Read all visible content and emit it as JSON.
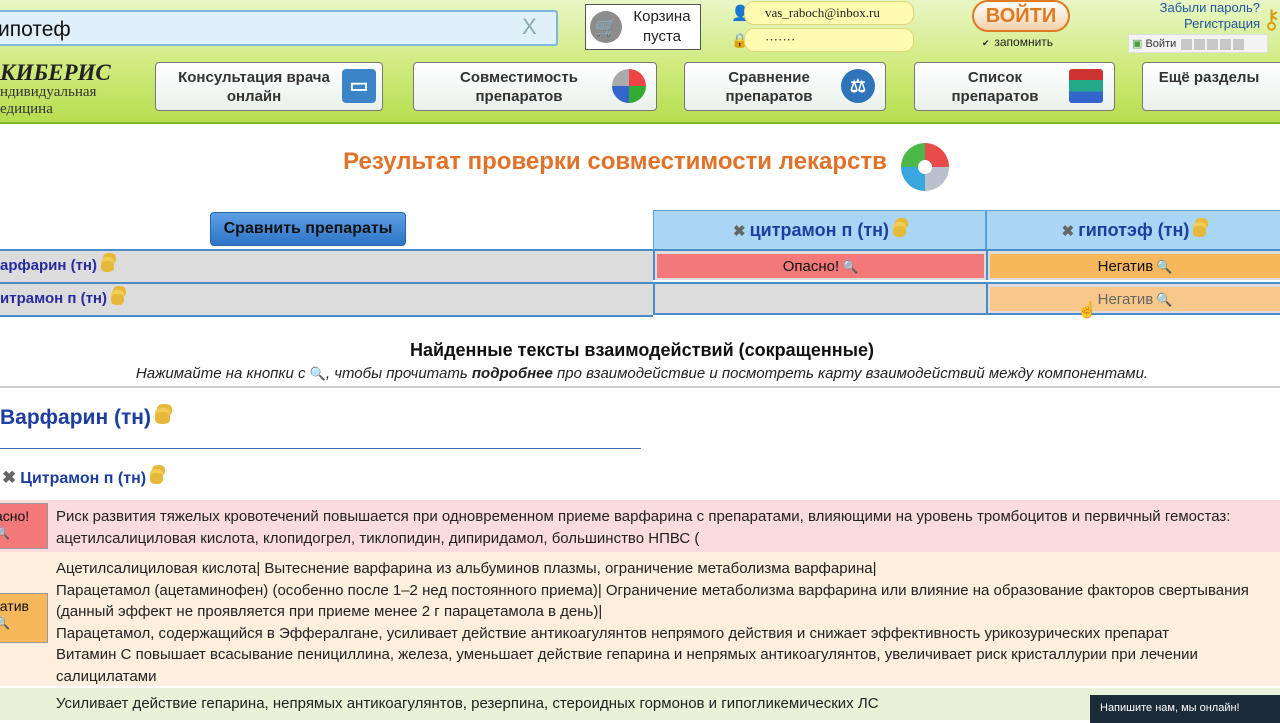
{
  "header": {
    "search_value": "ипотеф",
    "search_clear": "X",
    "cart_label": "Корзина пуста",
    "login_user": "vas_raboch@inbox.ru",
    "login_password": "·······",
    "login_button": "ВОЙТИ",
    "remember_label": "запомнить",
    "forgot_password": "Забыли пароль?",
    "register": "Регистрация",
    "social_label": "Войти",
    "logo_title": "КИБЕРИС",
    "logo_subtitle": "ндивидуальная едицина"
  },
  "nav": [
    {
      "label": "Консультация врача онлайн",
      "icon": "monitor-icon"
    },
    {
      "label": "Совместимость препаратов",
      "icon": "puzzle-icon"
    },
    {
      "label": "Сравнение препаратов",
      "icon": "scales-icon"
    },
    {
      "label": "Список препаратов",
      "icon": "books-icon"
    },
    {
      "label": "Ещё разделы",
      "icon": ""
    }
  ],
  "page_title": "Результат проверки совместимости лекарств",
  "compare_button": "Сравнить препараты",
  "table": {
    "columns": [
      "цитрамон п (тн)",
      "гипотэф (тн)"
    ],
    "rows": [
      {
        "label": "арфарин (тн)",
        "cells": [
          "Опасно!",
          "Негатив"
        ]
      },
      {
        "label": "итрамон п (тн)",
        "cells": [
          "",
          "Негатив"
        ]
      }
    ]
  },
  "found": {
    "title": "Найденные тексты взаимодействий (сокращенные)",
    "hint_prefix": "Нажимайте на кнопки с",
    "hint_mid": ", чтобы прочитать",
    "hint_bold": "подробнее",
    "hint_suffix": "про взаимодействие и посмотреть карту взаимодействий между компонентами."
  },
  "detail": {
    "drug": "Варфарин (тн)",
    "subdrug": "Цитрамон п (тн)",
    "items": [
      {
        "badge": "асно!",
        "text": "Риск развития тяжелых кровотечений повышается при одновременном приеме варфарина с препаратами, влияющими на уровень тромбоцитов и первичный гемостаз: ацетилсалициловая кислота, клопидогрел, тиклопидин, дипиридамол, большинство НПВС ("
      },
      {
        "badge": "гатив",
        "text": "Ацетилсалициловая кислота| Вытеснение варфарина из альбуминов плазмы, ограничение метаболизма варфарина|\nПарацетамол (ацетаминофен) (особенно после 1–2 нед постоянного приема)| Ограничение метаболизма варфарина или влияние на образование факторов свертывания (данный эффект не проявляется при приеме менее 2 г парацетамола в день)|\nПарацетамол, содержащийся в Эффералгане, усиливает действие антикоагулянтов непрямого действия и снижает эффективность урикозурических препарат\nВитамин С повышает всасывание пенициллина, железа, уменьшает действие гепарина и непрямых антикоагулянтов, увеличивает риск кристаллурии при лечении салицилатами"
      },
      {
        "badge": "",
        "text": "Усиливает действие гепарина, непрямых антикоагулянтов, резерпина, стероидных гормонов и гипогликемических ЛС"
      }
    ]
  },
  "chat_widget": "Напишите нам, мы онлайн!",
  "colors": {
    "danger": "#f2787a",
    "negative": "#f6b85b",
    "danger_row": "#fbdcdc",
    "negative_row": "#fdeedd",
    "green_row": "#e7f2d9",
    "title": "#e0722a",
    "link": "#1d3ea0"
  }
}
